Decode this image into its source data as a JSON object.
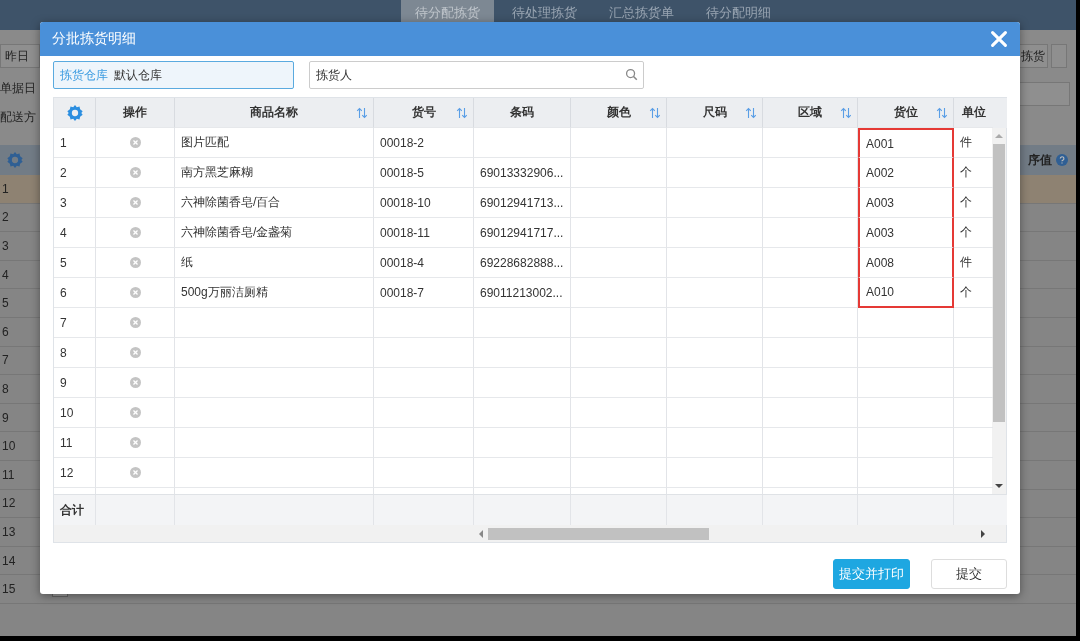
{
  "background": {
    "tabs": [
      {
        "label": "待分配拣货",
        "selected": true
      },
      {
        "label": "待处理拣货",
        "selected": false
      },
      {
        "label": "汇总拣货单",
        "selected": false
      },
      {
        "label": "待分配明细",
        "selected": false
      }
    ],
    "left_labels": [
      "昨日",
      "单据日",
      "配送方"
    ],
    "right_button": "拣货",
    "sort_label": "序值",
    "rows": [
      {
        "no": "1",
        "selected": true
      },
      {
        "no": "2",
        "selected": false
      },
      {
        "no": "3",
        "selected": false
      },
      {
        "no": "4",
        "selected": false
      },
      {
        "no": "5",
        "selected": false
      },
      {
        "no": "6",
        "selected": false
      },
      {
        "no": "7",
        "selected": false
      },
      {
        "no": "8",
        "selected": false
      },
      {
        "no": "9",
        "selected": false
      },
      {
        "no": "10",
        "selected": false
      },
      {
        "no": "11",
        "selected": false
      },
      {
        "no": "12",
        "selected": false
      },
      {
        "no": "13",
        "selected": false
      },
      {
        "no": "14",
        "selected": false
      },
      {
        "no": "15",
        "selected": false,
        "checked": false
      }
    ]
  },
  "dialog": {
    "title": "分批拣货明细",
    "warehouse": {
      "label": "拣货仓库",
      "value": "默认仓库"
    },
    "picker": {
      "placeholder": "拣货人"
    },
    "table": {
      "columns": [
        {
          "label": "操作",
          "sortable": false
        },
        {
          "label": "商品名称",
          "sortable": true
        },
        {
          "label": "货号",
          "sortable": true
        },
        {
          "label": "条码",
          "sortable": false
        },
        {
          "label": "颜色",
          "sortable": true
        },
        {
          "label": "尺码",
          "sortable": true
        },
        {
          "label": "区域",
          "sortable": true
        },
        {
          "label": "货位",
          "sortable": true
        },
        {
          "label": "单位",
          "sortable": false
        }
      ],
      "rows": [
        {
          "no": "1",
          "name": "图片匹配",
          "code": "00018-2",
          "location": "A001",
          "unit": "件",
          "marked": true
        },
        {
          "no": "2",
          "name": "南方黑芝麻糊",
          "code": "00018-5",
          "barcode": "69013332906...",
          "location": "A002",
          "unit": "个",
          "marked": true
        },
        {
          "no": "3",
          "name": "六神除菌香皂/百合",
          "code": "00018-10",
          "barcode": "69012941713...",
          "location": "A003",
          "unit": "个",
          "marked": true
        },
        {
          "no": "4",
          "name": "六神除菌香皂/金盏菊",
          "code": "00018-11",
          "barcode": "69012941717...",
          "location": "A003",
          "unit": "个",
          "marked": true
        },
        {
          "no": "5",
          "name": "纸",
          "code": "00018-4",
          "barcode": "69228682888...",
          "location": "A008",
          "unit": "件",
          "marked": true
        },
        {
          "no": "6",
          "name": "500g万丽洁厕精",
          "code": "00018-7",
          "barcode": "69011213002...",
          "location": "A010",
          "unit": "个",
          "marked": true
        },
        {
          "no": "7",
          "marked": false
        },
        {
          "no": "8",
          "marked": false
        },
        {
          "no": "9",
          "marked": false
        },
        {
          "no": "10",
          "marked": false
        },
        {
          "no": "11",
          "marked": false
        },
        {
          "no": "12",
          "marked": false
        }
      ],
      "footer_label": "合计"
    },
    "buttons": [
      {
        "label": "提交并打印",
        "primary": true
      },
      {
        "label": "提交",
        "primary": false
      }
    ]
  }
}
